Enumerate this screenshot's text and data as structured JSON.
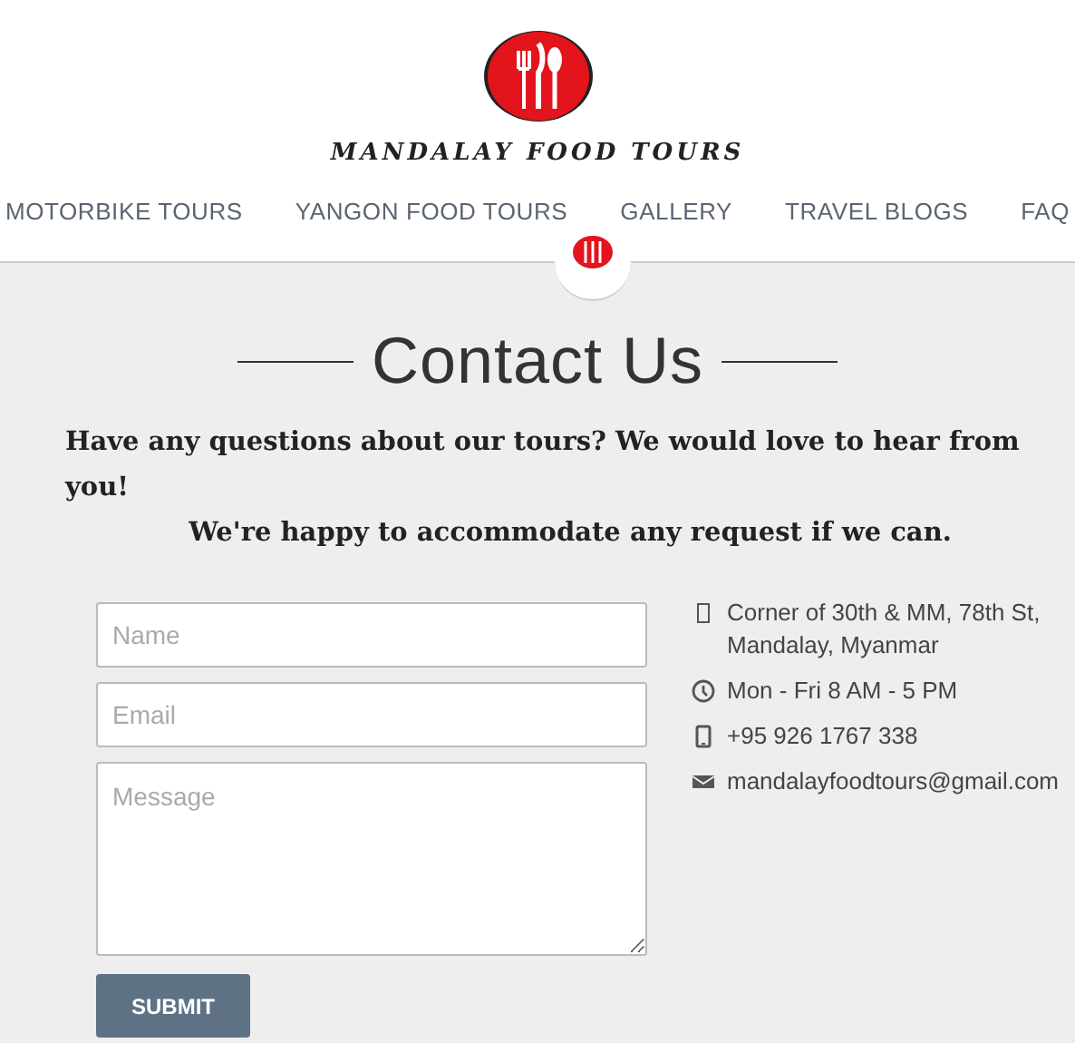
{
  "logo": {
    "text": "MANDALAY FOOD TOURS"
  },
  "nav": [
    {
      "label": "MOTORBIKE TOURS"
    },
    {
      "label": "YANGON FOOD TOURS"
    },
    {
      "label": "GALLERY"
    },
    {
      "label": "TRAVEL BLOGS"
    },
    {
      "label": "FAQ"
    }
  ],
  "heading": "Contact Us",
  "intro": [
    "Have any questions about our tours? We would love to hear from you!",
    "We're happy to accommodate any request if we can."
  ],
  "form": {
    "fields": [
      {
        "kind": "input",
        "placeholder": "Name"
      },
      {
        "kind": "input",
        "placeholder": "Email"
      },
      {
        "kind": "textarea",
        "placeholder": "Message"
      }
    ],
    "submit": "SUBMIT"
  },
  "contact": [
    {
      "kind": "address",
      "text": "Corner of 30th & MM, 78th St, Mandalay, Myanmar"
    },
    {
      "kind": "hours",
      "text": "Mon - Fri 8 AM - 5 PM"
    },
    {
      "kind": "phone",
      "text": "+95 926 1767 338"
    },
    {
      "kind": "email",
      "text": "mandalayfoodtours@gmail.com"
    }
  ]
}
